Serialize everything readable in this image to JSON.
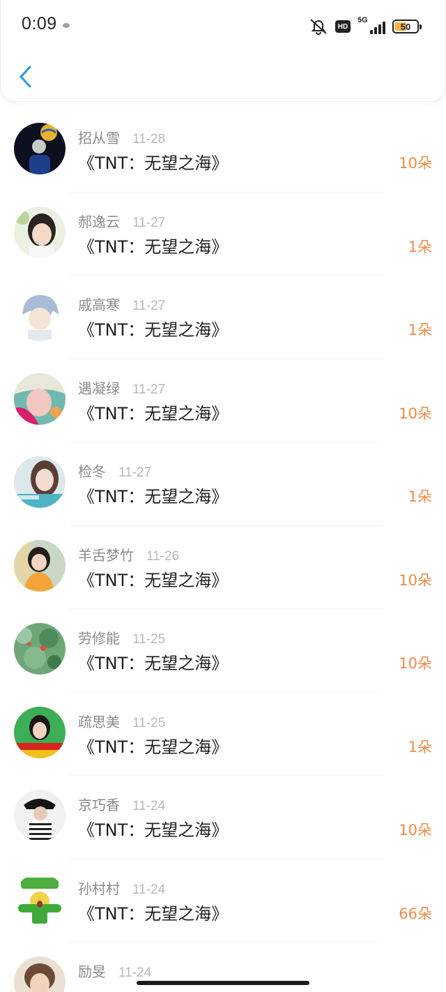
{
  "status_bar": {
    "time": "0:09",
    "network_label": "5G",
    "hd_label": "HD",
    "battery": "50",
    "icons": [
      "mute-icon",
      "hd-icon",
      "signal-icon",
      "battery-icon"
    ]
  },
  "header": {
    "back_icon": "chevron-left-icon"
  },
  "colors": {
    "accent_amount": "#f08a48",
    "back": "#2c93e6",
    "name": "#8a8a8a",
    "date": "#b8b8b8"
  },
  "list": {
    "items": [
      {
        "name": "招从雪",
        "date": "11-28",
        "title": "《TNT：无望之海》",
        "amount": "10朵"
      },
      {
        "name": "郝逸云",
        "date": "11-27",
        "title": "《TNT：无望之海》",
        "amount": "1朵"
      },
      {
        "name": "戚高寒",
        "date": "11-27",
        "title": "《TNT：无望之海》",
        "amount": "1朵"
      },
      {
        "name": "遇凝绿",
        "date": "11-27",
        "title": "《TNT：无望之海》",
        "amount": "10朵"
      },
      {
        "name": "检冬",
        "date": "11-27",
        "title": "《TNT：无望之海》",
        "amount": "1朵"
      },
      {
        "name": "羊舌梦竹",
        "date": "11-26",
        "title": "《TNT：无望之海》",
        "amount": "10朵"
      },
      {
        "name": "劳修能",
        "date": "11-25",
        "title": "《TNT：无望之海》",
        "amount": "10朵"
      },
      {
        "name": "疏思美",
        "date": "11-25",
        "title": "《TNT：无望之海》",
        "amount": "1朵"
      },
      {
        "name": "京巧香",
        "date": "11-24",
        "title": "《TNT：无望之海》",
        "amount": "10朵"
      },
      {
        "name": "孙村村",
        "date": "11-24",
        "title": "《TNT：无望之海》",
        "amount": "66朵"
      },
      {
        "name": "励旻",
        "date": "11-24"
      }
    ]
  }
}
